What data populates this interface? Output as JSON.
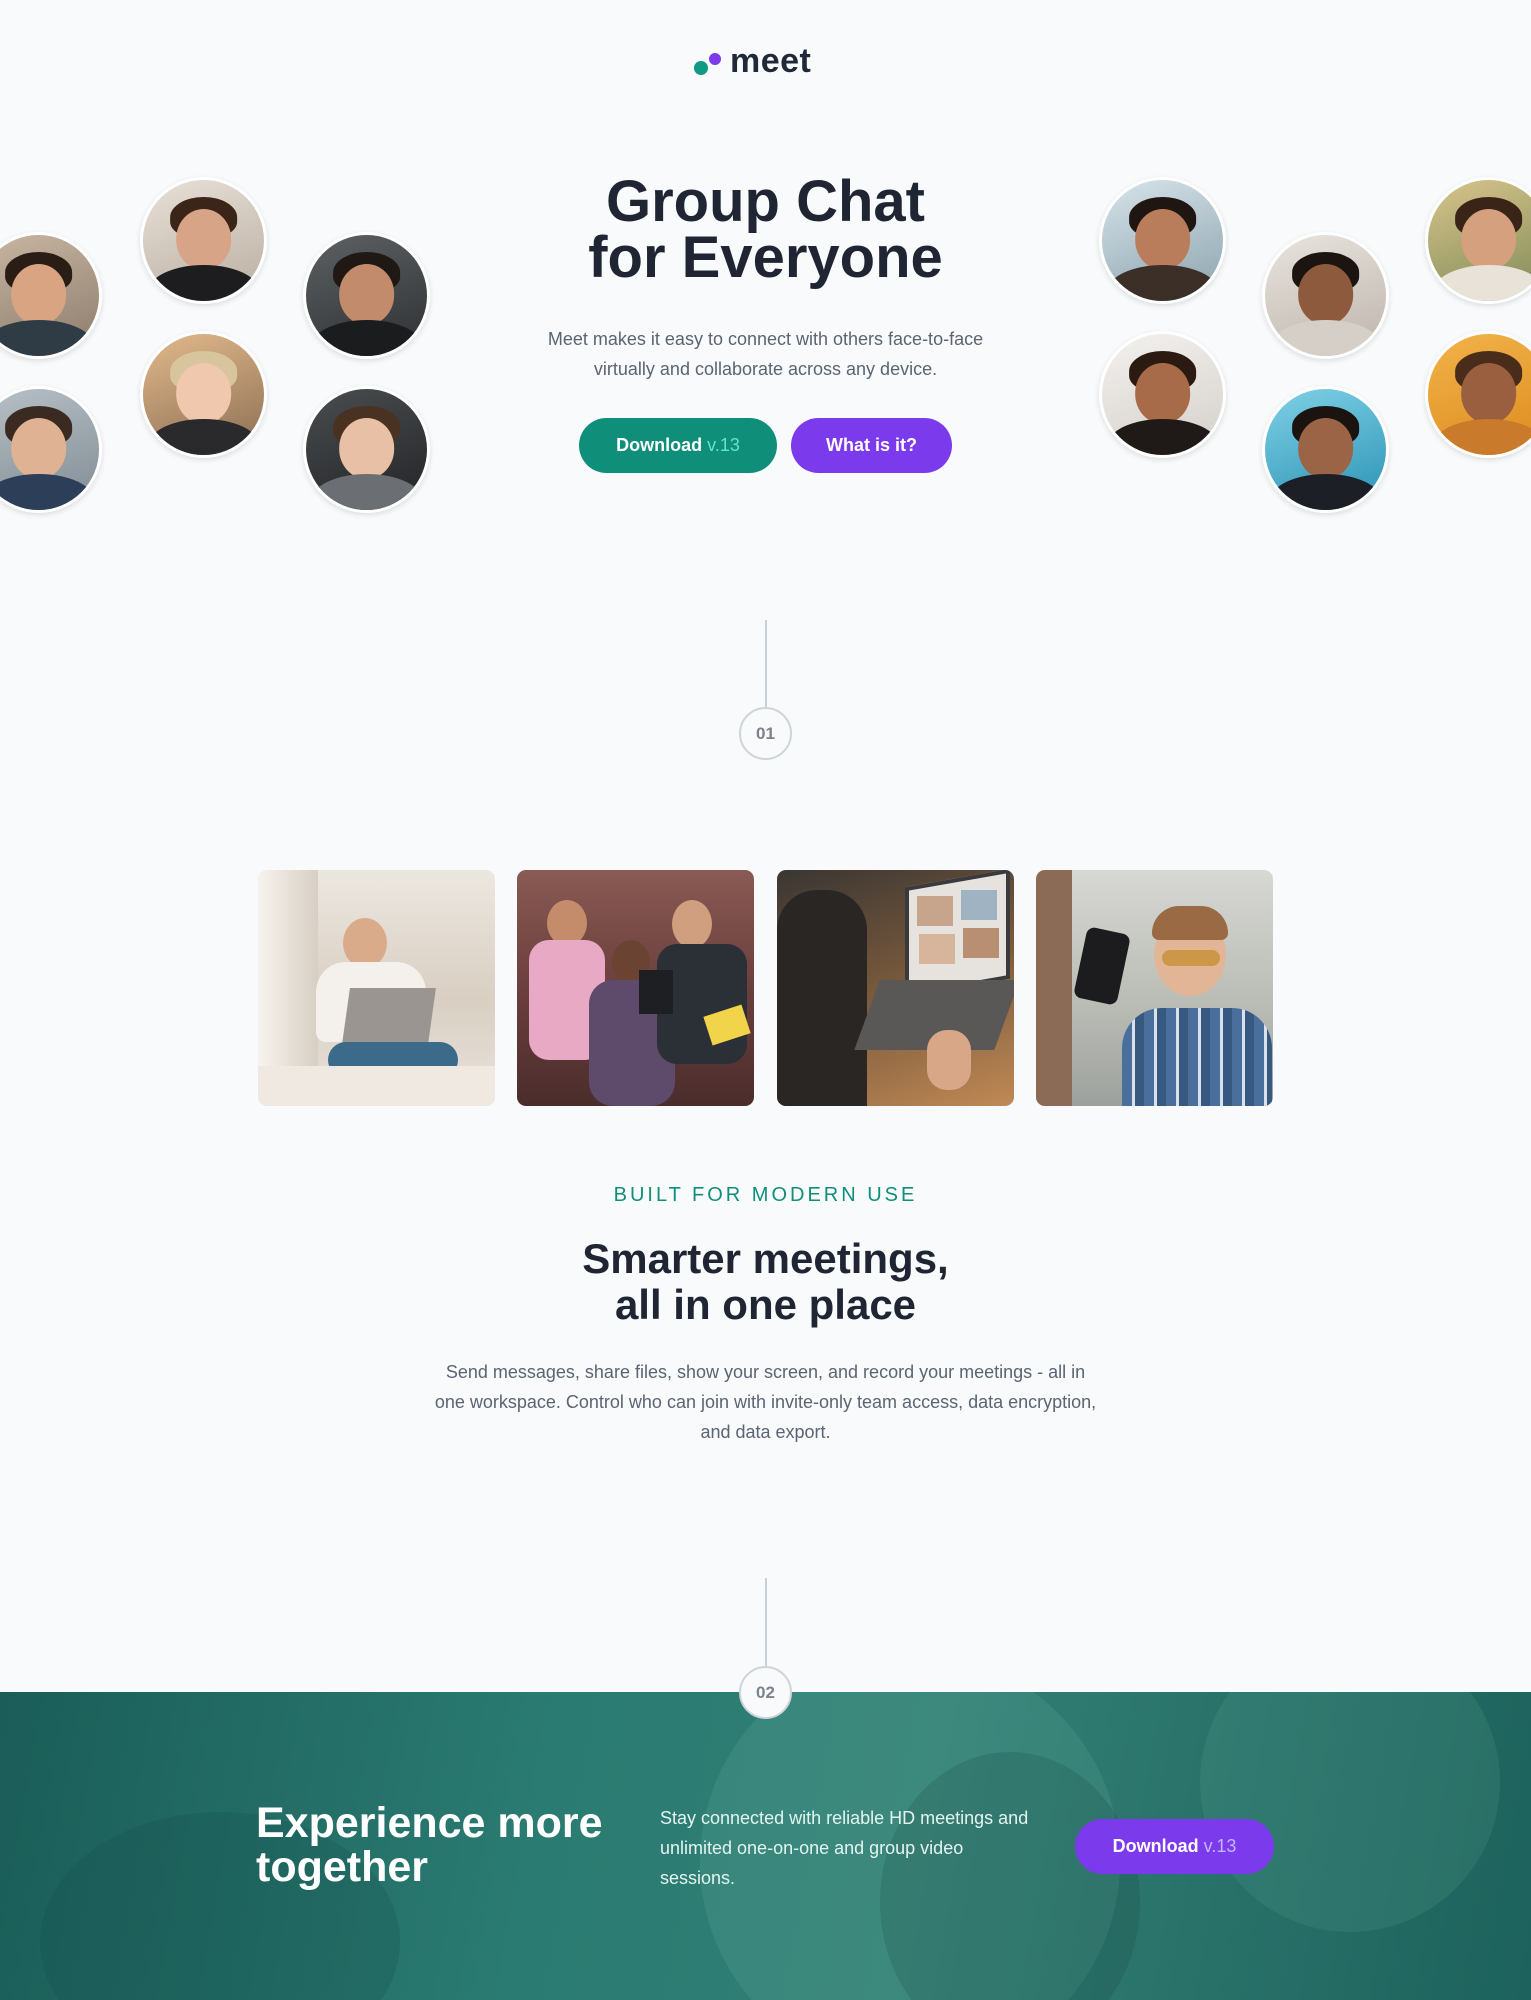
{
  "logo": {
    "text": "meet"
  },
  "hero": {
    "title_line1": "Group Chat",
    "title_line2": "for Everyone",
    "description": "Meet makes it easy to connect with others face-to-face virtually and collaborate across any device.",
    "download_label": "Download",
    "download_version": "v.13",
    "whatis_label": "What is it?"
  },
  "markers": {
    "first": "01",
    "second": "02"
  },
  "features": {
    "eyebrow": "BUILT FOR MODERN USE",
    "title_line1": "Smarter meetings,",
    "title_line2": "all in one place",
    "description": "Send messages, share files, show your screen, and record your meetings - all in one workspace. Control who can join with invite-only team access, data encryption, and data export."
  },
  "cta": {
    "title_line1": "Experience more",
    "title_line2": "together",
    "description": "Stay connected with reliable HD meetings and unlimited one-on-one and group video sessions.",
    "download_label": "Download",
    "download_version": "v.13"
  },
  "colors": {
    "brand_teal": "#0f8f7a",
    "brand_purple": "#7c3aed",
    "background": "#f8fafc",
    "heading": "#1f2533",
    "band": "#2a7b72"
  }
}
